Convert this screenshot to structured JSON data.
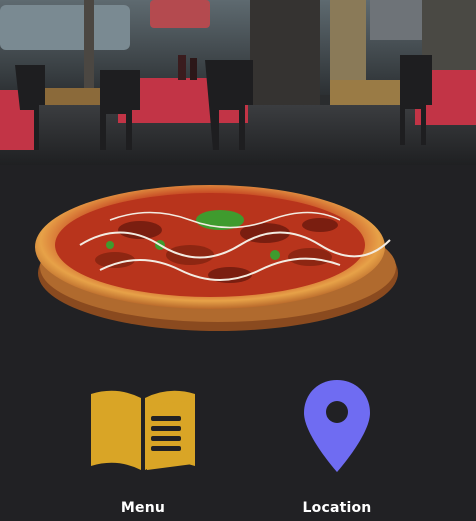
{
  "hero": {
    "image_name": "restaurant-interior-photo"
  },
  "feature": {
    "image_name": "pizza-photo"
  },
  "nav": {
    "items": [
      {
        "label": "Menu",
        "icon": "menu-book-icon",
        "color": "#D9A526"
      },
      {
        "label": "Location",
        "icon": "location-pin-icon",
        "color": "#6F6CF2"
      }
    ]
  }
}
